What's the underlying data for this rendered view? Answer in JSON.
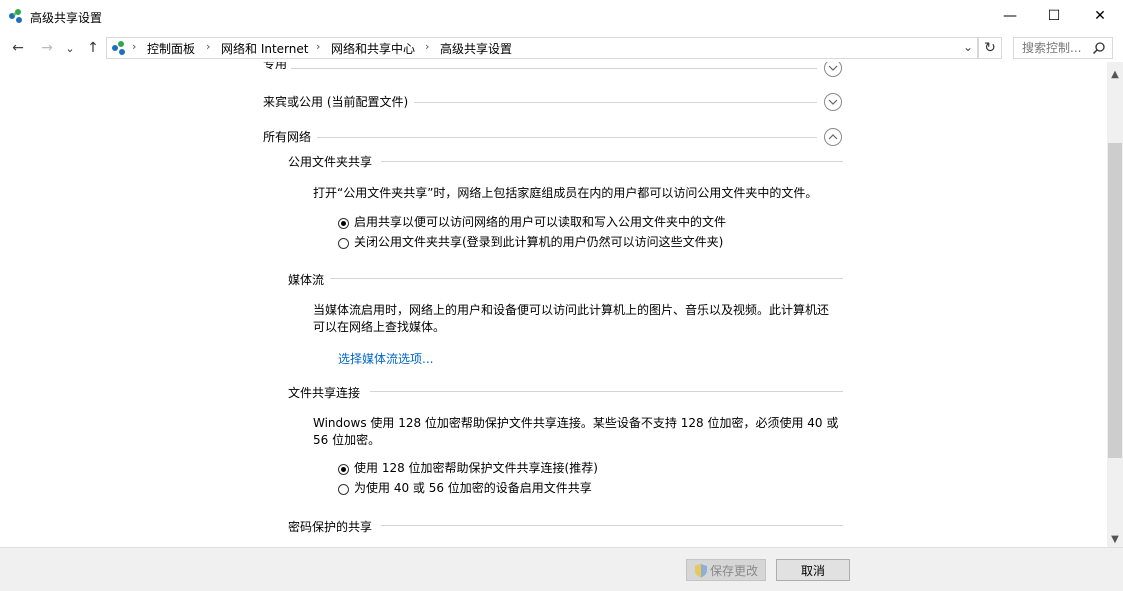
{
  "window": {
    "title": "高级共享设置",
    "minimize": "—",
    "maximize": "☐",
    "close": "✕"
  },
  "nav": {
    "back": "←",
    "forward": "→",
    "recent": "⌄",
    "up": "↑",
    "breadcrumbs": [
      "控制面板",
      "网络和 Internet",
      "网络和共享中心",
      "高级共享设置"
    ],
    "separator": "›",
    "dropdown": "⌄",
    "refresh": "↻",
    "search_placeholder": "搜索控制..."
  },
  "profiles": {
    "private_partial": "专用",
    "guest_public": "来宾或公用 (当前配置文件)",
    "all_networks": "所有网络"
  },
  "public_folder": {
    "heading": "公用文件夹共享",
    "description": "打开“公用文件夹共享”时，网络上包括家庭组成员在内的用户都可以访问公用文件夹中的文件。",
    "options": [
      "启用共享以便可以访问网络的用户可以读取和写入公用文件夹中的文件",
      "关闭公用文件夹共享(登录到此计算机的用户仍然可以访问这些文件夹)"
    ],
    "selected": 0
  },
  "media": {
    "heading": "媒体流",
    "description_line1": "当媒体流启用时，网络上的用户和设备便可以访问此计算机上的图片、音乐以及视频。此计算机还",
    "description_line2": "可以在网络上查找媒体。",
    "link": "选择媒体流选项..."
  },
  "file_sharing": {
    "heading": "文件共享连接",
    "description_line1": "Windows 使用 128 位加密帮助保护文件共享连接。某些设备不支持 128 位加密，必须使用 40 或",
    "description_line2": "56 位加密。",
    "options": [
      "使用 128 位加密帮助保护文件共享连接(推荐)",
      "为使用 40 或 56 位加密的设备启用文件共享"
    ],
    "selected": 0
  },
  "password": {
    "heading": "密码保护的共享"
  },
  "scroll": {
    "up": "▲",
    "down": "▼"
  },
  "footer": {
    "save": "保存更改",
    "cancel": "取消"
  },
  "colors": {
    "link": "#0066cc",
    "footer_bg": "#f0f0f0"
  }
}
